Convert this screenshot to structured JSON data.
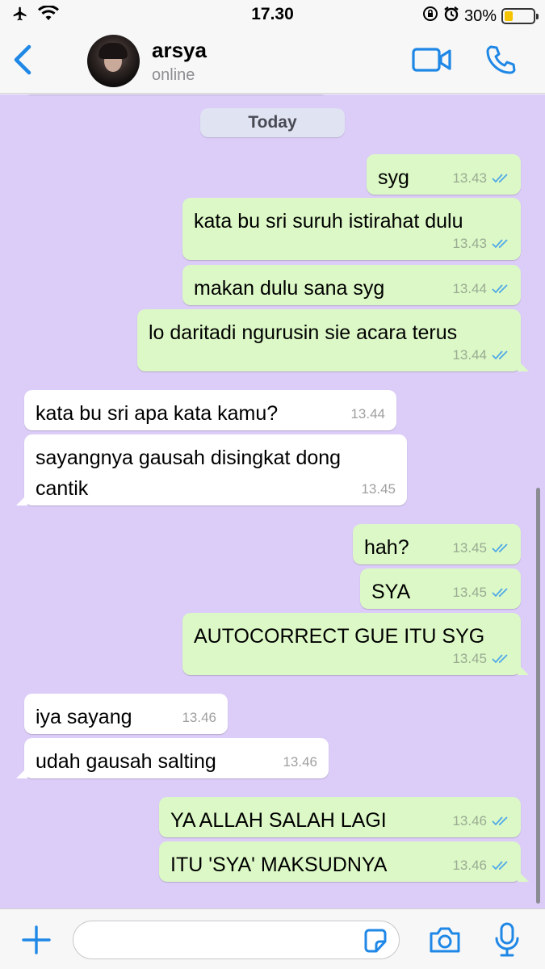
{
  "status_bar": {
    "time": "17.30",
    "battery_percent": "30%",
    "battery_level": 0.3,
    "icons": [
      "airplane-icon",
      "wifi-icon",
      "orientation-lock-icon",
      "alarm-icon",
      "battery-icon"
    ]
  },
  "header": {
    "contact_name": "arsya",
    "contact_status": "online",
    "icons": [
      "back-chevron-icon",
      "video-call-icon",
      "phone-call-icon"
    ]
  },
  "chat": {
    "date_label": "Today",
    "messages": [
      {
        "direction": "out",
        "text": "syg",
        "time": "13.43",
        "read": true
      },
      {
        "direction": "out",
        "text": "kata bu sri suruh istirahat dulu",
        "time": "13.43",
        "read": true
      },
      {
        "direction": "out",
        "text": "makan dulu sana syg",
        "time": "13.44",
        "read": true
      },
      {
        "direction": "out",
        "text": "lo daritadi ngurusin sie acara terus",
        "time": "13.44",
        "read": true
      },
      {
        "direction": "in",
        "text": "kata bu sri apa kata kamu?",
        "time": "13.44"
      },
      {
        "direction": "in",
        "text": "sayangnya gausah disingkat dong cantik",
        "lines": [
          "sayangnya gausah disingkat dong",
          "cantik"
        ],
        "time": "13.45"
      },
      {
        "direction": "out",
        "text": "hah?",
        "time": "13.45",
        "read": true
      },
      {
        "direction": "out",
        "text": "SYA",
        "time": "13.45",
        "read": true
      },
      {
        "direction": "out",
        "text": "AUTOCORRECT GUE ITU SYG",
        "time": "13.45",
        "read": true
      },
      {
        "direction": "in",
        "text": "iya sayang",
        "time": "13.46"
      },
      {
        "direction": "in",
        "text": "udah gausah salting",
        "time": "13.46"
      },
      {
        "direction": "out",
        "text": "YA ALLAH SALAH LAGI",
        "time": "13.46",
        "read": true
      },
      {
        "direction": "out",
        "text": "ITU 'SYA' MAKSUDNYA",
        "time": "13.46",
        "read": true
      }
    ]
  },
  "input_bar": {
    "placeholder": "",
    "value": "",
    "icons": [
      "plus-icon",
      "sticker-icon",
      "camera-icon",
      "microphone-icon"
    ]
  },
  "colors": {
    "chat_background": "#dccdf8",
    "outgoing_bubble": "#dcf8c6",
    "incoming_bubble": "#ffffff",
    "accent_blue": "#1f87e6",
    "read_ticks": "#4fa8e8"
  }
}
